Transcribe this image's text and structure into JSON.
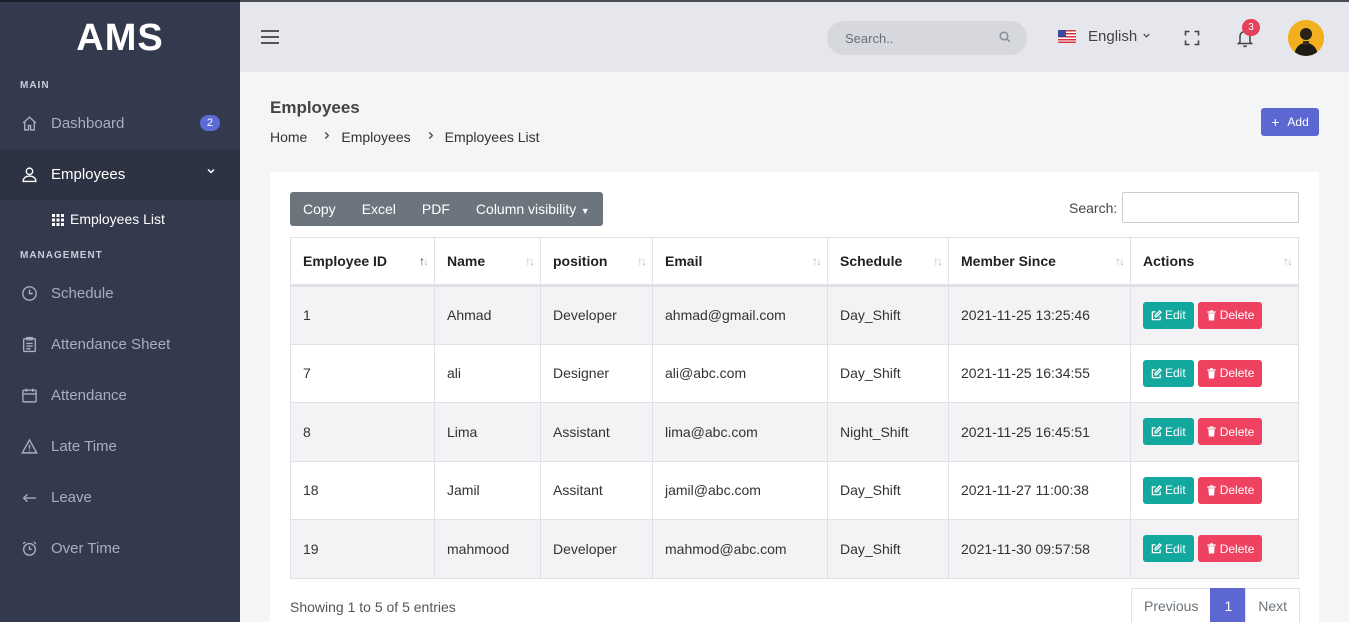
{
  "app": {
    "logo": "AMS"
  },
  "sidebar": {
    "section_main": "MAIN",
    "section_management": "MANAGEMENT",
    "dashboard": {
      "label": "Dashboard",
      "badge": "2",
      "icon": "home-icon"
    },
    "employees": {
      "label": "Employees",
      "icon": "user-icon"
    },
    "employees_list": {
      "label": "Employees List",
      "icon": "grid-dots-icon"
    },
    "management_items": [
      {
        "label": "Schedule",
        "icon": "clock-icon"
      },
      {
        "label": "Attendance Sheet",
        "icon": "clipboard-icon"
      },
      {
        "label": "Attendance",
        "icon": "calendar-icon"
      },
      {
        "label": "Late Time",
        "icon": "warning-icon"
      },
      {
        "label": "Leave",
        "icon": "arrow-left-icon"
      },
      {
        "label": "Over Time",
        "icon": "alarm-icon"
      }
    ]
  },
  "topbar": {
    "search_placeholder": "Search..",
    "language": "English",
    "notifications_count": "3"
  },
  "page": {
    "title": "Employees",
    "breadcrumb": [
      "Home",
      "Employees",
      "Employees List"
    ],
    "add_label": "Add"
  },
  "table_tools": {
    "buttons": [
      "Copy",
      "Excel",
      "PDF",
      "Column visibility"
    ],
    "search_label": "Search:"
  },
  "table": {
    "headers": [
      "Employee ID",
      "Name",
      "position",
      "Email",
      "Schedule",
      "Member Since",
      "Actions"
    ],
    "rows": [
      [
        "1",
        "Ahmad",
        "Developer",
        "ahmad@gmail.com",
        "Day_Shift",
        "2021-11-25 13:25:46"
      ],
      [
        "7",
        "ali",
        "Designer",
        "ali@abc.com",
        "Day_Shift",
        "2021-11-25 16:34:55"
      ],
      [
        "8",
        "Lima",
        "Assistant",
        "lima@abc.com",
        "Night_Shift",
        "2021-11-25 16:45:51"
      ],
      [
        "18",
        "Jamil",
        "Assitant",
        "jamil@abc.com",
        "Day_Shift",
        "2021-11-27 11:00:38"
      ],
      [
        "19",
        "mahmood",
        "Developer",
        "mahmod@abc.com",
        "Day_Shift",
        "2021-11-30 09:57:58"
      ]
    ],
    "edit_label": "Edit",
    "delete_label": "Delete"
  },
  "footer": {
    "showing": "Showing 1 to 5 of 5 entries",
    "previous": "Previous",
    "current_page": "1",
    "next": "Next"
  },
  "colors": {
    "sidebar_bg": "#343a4d",
    "accent": "#5c67d1",
    "edit": "#13a89e",
    "delete": "#ee4260",
    "badge": "#e3435a"
  }
}
